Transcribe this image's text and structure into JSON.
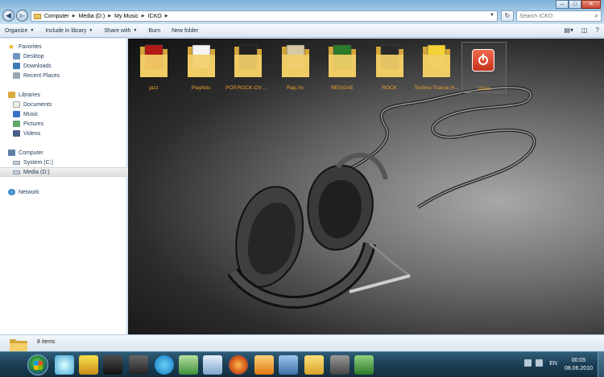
{
  "window": {
    "minimize": "–",
    "maximize": "□",
    "close": "✕"
  },
  "address": {
    "crumbs": [
      "Computer",
      "Media (D:)",
      "My Music",
      "ICKO"
    ]
  },
  "search": {
    "placeholder": "Search ICKO"
  },
  "toolbar": {
    "organize": "Organize",
    "include_in_library": "Include in library",
    "share_with": "Share with",
    "burn": "Burn",
    "new_folder": "New folder"
  },
  "nav": {
    "favorites": "Favorites",
    "desktop": "Desktop",
    "downloads": "Downloads",
    "recent_places": "Recent Places",
    "libraries": "Libraries",
    "documents": "Documents",
    "music": "Music",
    "pictures": "Pictures",
    "videos": "Videos",
    "computer": "Computer",
    "system_c": "System (C:)",
    "media_d": "Media (D:)",
    "network": "Network"
  },
  "items": [
    {
      "label": "jazz",
      "cover": "#b01a14"
    },
    {
      "label": "Playlists",
      "cover": "#f4f4f4"
    },
    {
      "label": "POP,ROCK-OVO-...",
      "cover": "#222222"
    },
    {
      "label": "Rap,Yo",
      "cover": "#d6c9a4"
    },
    {
      "label": "REGGAE",
      "cover": "#2b7a2a"
    },
    {
      "label": "ROCK",
      "cover": "#2a2a2a"
    },
    {
      "label": "Techno-Trance-H...",
      "cover": "#f2d234"
    },
    {
      "label": "Video",
      "cover": "#d8402a"
    }
  ],
  "status": {
    "count": "8 items"
  },
  "taskbar": {
    "lang": "EN",
    "time": "00:05",
    "date": "08.06.2010"
  },
  "colors": {
    "label_orange": "#f0a030",
    "taskbar": "#1b3e55"
  }
}
